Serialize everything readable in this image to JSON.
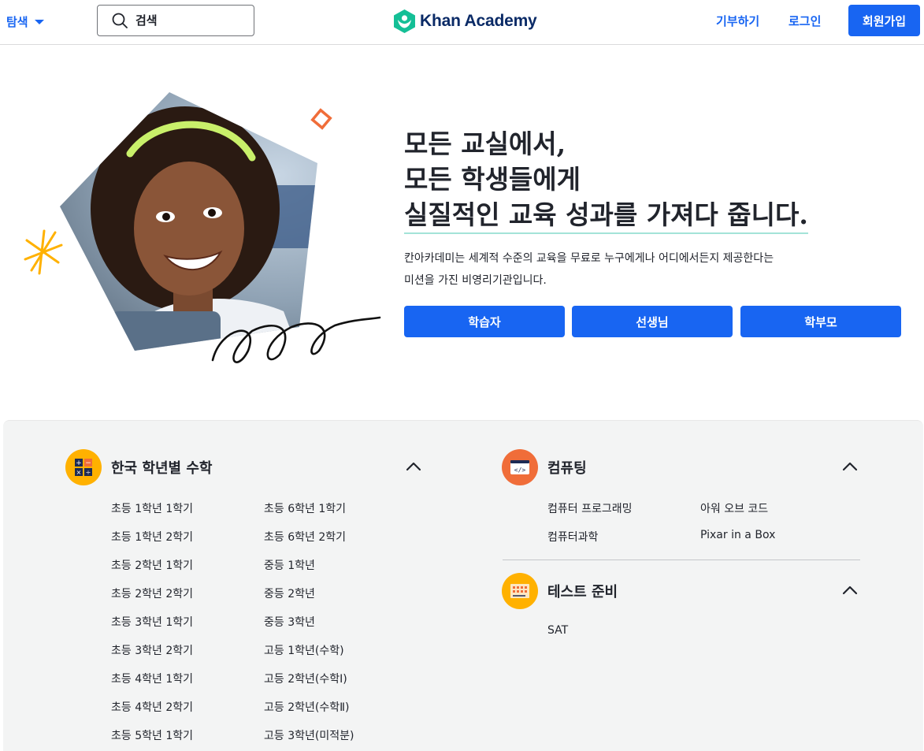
{
  "header": {
    "explore_label": "탐색",
    "search_placeholder": "검색",
    "logo_text": "Khan Academy",
    "donate_label": "기부하기",
    "login_label": "로그인",
    "signup_label": "회원가입"
  },
  "hero": {
    "title_line1": "모든 교실에서,",
    "title_line2": "모든 학생들에게",
    "title_line3": "실질적인 교육 성과를 가져다 줍니다.",
    "desc_line1": "칸아카데미는 세계적 수준의 교육을 무료로 누구에게나 어디에서든지 제공한다는",
    "desc_line2": "미션을 가진 비영리기관입니다.",
    "buttons": [
      "학습자",
      "선생님",
      "학부모"
    ]
  },
  "sections": {
    "korean_math": {
      "title": "한국 학년별 수학",
      "col1": [
        "초등 1학년 1학기",
        "초등 1학년 2학기",
        "초등 2학년 1학기",
        "초등 2학년 2학기",
        "초등 3학년 1학기",
        "초등 3학년 2학기",
        "초등 4학년 1학기",
        "초등 4학년 2학기",
        "초등 5학년 1학기"
      ],
      "col2": [
        "초등 6학년 1학기",
        "초등 6학년 2학기",
        "중등 1학년",
        "중등 2학년",
        "중등 3학년",
        "고등 1학년(수학)",
        "고등 2학년(수학Ⅰ)",
        "고등 2학년(수학Ⅱ)",
        "고등 3학년(미적분)"
      ]
    },
    "computing": {
      "title": "컴퓨팅",
      "col1": [
        "컴퓨터 프로그래밍",
        "컴퓨터과학"
      ],
      "col2": [
        "아워 오브 코드",
        "Pixar in a Box"
      ]
    },
    "test_prep": {
      "title": "테스트 준비",
      "items": [
        "SAT"
      ]
    }
  },
  "colors": {
    "brand_blue": "#1865f2",
    "logo_green": "#14bf96",
    "math_icon_bg": "#ffb100",
    "computing_icon_bg": "#f06d39",
    "test_icon_bg": "#ffb100"
  },
  "icons": {
    "search": "search-icon",
    "explore_caret": "caret-down-icon",
    "logo": "khan-hexagon-logo",
    "collapse": "chevron-up-icon"
  }
}
